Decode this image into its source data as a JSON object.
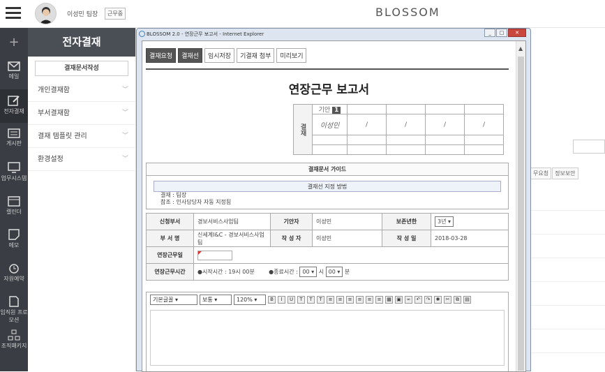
{
  "topbar": {
    "brand": "BLOSSOM",
    "user_name": "이성민 팀장",
    "user_status": "근무중"
  },
  "rail": {
    "items": [
      {
        "label": "메일",
        "icon": "mail-icon"
      },
      {
        "label": "전자결재",
        "icon": "edit-icon"
      },
      {
        "label": "게시판",
        "icon": "board-icon"
      },
      {
        "label": "업무시스템",
        "icon": "monitor-icon"
      },
      {
        "label": "캘린더",
        "icon": "calendar-icon"
      },
      {
        "label": "메모",
        "icon": "memo-icon"
      },
      {
        "label": "자원예약",
        "icon": "alarm-icon"
      },
      {
        "label": "임직원 프로모션",
        "icon": "document-icon"
      },
      {
        "label": "조직패키지",
        "icon": "org-icon"
      }
    ]
  },
  "menu": {
    "title": "전자결재",
    "new_button": "결재문서작성",
    "items": [
      "개인결재함",
      "부서결재함",
      "결재 템플릿 관리",
      "환경설정"
    ]
  },
  "background": {
    "tabs": [
      "무요청",
      "정보보안"
    ]
  },
  "window": {
    "title": "BLOSSOM 2.0 - 연장근무 보고서 - Internet Explorer",
    "toolbar": [
      "결재요청",
      "결재선",
      "임시저장",
      "기결재 첨부",
      "미리보기"
    ],
    "doc_title": "연장근무 보고서",
    "approval": {
      "label": "결재",
      "draft_label": "기안",
      "draft_num": "1",
      "signer": "이성민",
      "slashes": [
        "/",
        "/",
        "/",
        "/"
      ]
    },
    "guide": {
      "header": "결재문서 가이드",
      "inner_header": "결재선 지정 방법",
      "lines": [
        "결재 : 팀장",
        "참조 : 인사담당자 자동 지정됨"
      ]
    },
    "form": {
      "dept_label": "신청부서",
      "dept": "경보서비스사업팀",
      "drafter_label": "기안자",
      "drafter": "이성민",
      "retention_label": "보존년한",
      "retention": "3년",
      "dept2_label": "부 서 명",
      "dept2": "신세계I&C - 경보서비스사업팀",
      "writer_label": "작 성 자",
      "writer": "이성민",
      "date_label": "작 성 일",
      "date": "2018-03-28",
      "ot_date_label": "연장근무일",
      "ot_time_label": "연장근무시간",
      "start": "●시작시간 : 19시 00분",
      "end_label": "●종료시간 :",
      "end_hour": "00",
      "hour_unit": "시",
      "end_min": "00",
      "min_unit": "분"
    },
    "editor": {
      "font": "기본글꼴",
      "style": "보통",
      "size": "120%"
    }
  }
}
